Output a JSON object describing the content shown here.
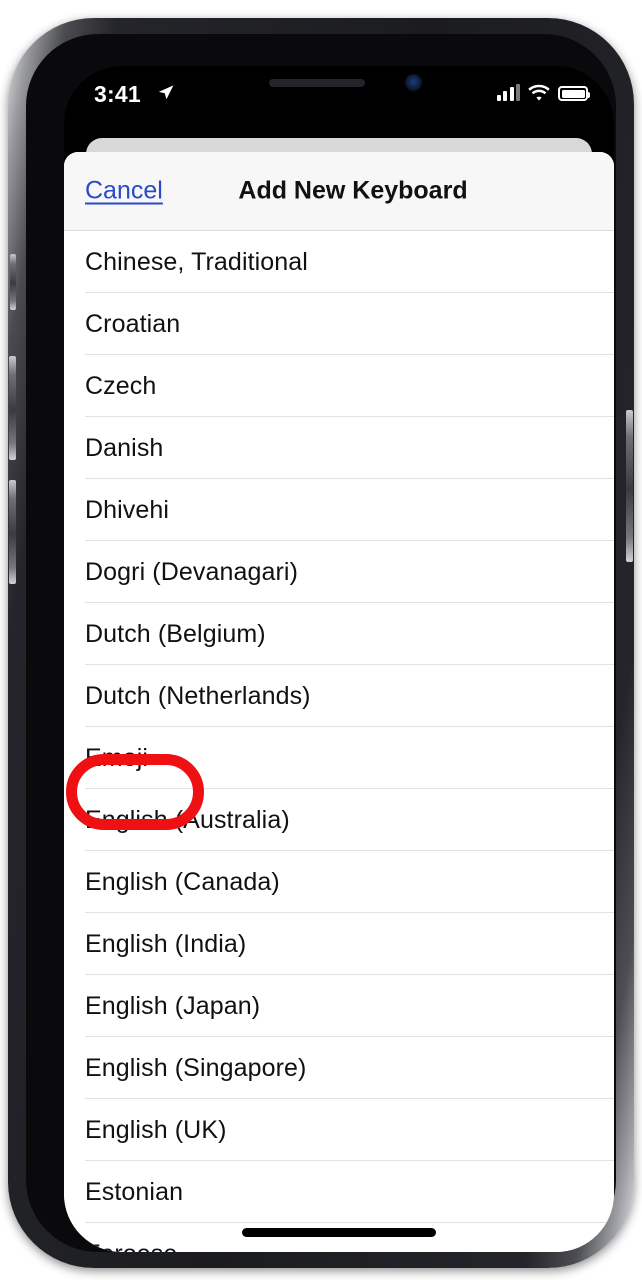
{
  "status_bar": {
    "time": "3:41",
    "location_arrow_icon": "location-arrow-icon",
    "cellular_signal_icon": "cellular-signal-icon",
    "wifi_icon": "wifi-icon",
    "battery_icon": "battery-icon",
    "battery_level_percent": 100
  },
  "notch": {
    "earpiece_speaker_icon": "earpiece-speaker",
    "front_camera_icon": "front-camera-icon"
  },
  "sheet": {
    "cancel_label": "Cancel",
    "title": "Add New Keyboard"
  },
  "keyboard_list": {
    "items": [
      {
        "label": "Chinese, Traditional"
      },
      {
        "label": "Croatian"
      },
      {
        "label": "Czech"
      },
      {
        "label": "Danish"
      },
      {
        "label": "Dhivehi"
      },
      {
        "label": "Dogri (Devanagari)"
      },
      {
        "label": "Dutch (Belgium)"
      },
      {
        "label": "Dutch (Netherlands)"
      },
      {
        "label": "Emoji"
      },
      {
        "label": "English (Australia)"
      },
      {
        "label": "English (Canada)"
      },
      {
        "label": "English (India)"
      },
      {
        "label": "English (Japan)"
      },
      {
        "label": "English (Singapore)"
      },
      {
        "label": "English (UK)"
      },
      {
        "label": "Estonian"
      },
      {
        "label": "Faroese"
      }
    ]
  },
  "annotation": {
    "target_label": "Emoji",
    "shape": "ellipse",
    "color": "#ee1012"
  },
  "home_indicator": {
    "name": "home-indicator"
  },
  "colors": {
    "link_blue": "#2a49c8",
    "text_primary": "#111113",
    "separator": "#e2e2e4",
    "header_background": "#f7f7f8",
    "annotation_red": "#ee1012"
  }
}
